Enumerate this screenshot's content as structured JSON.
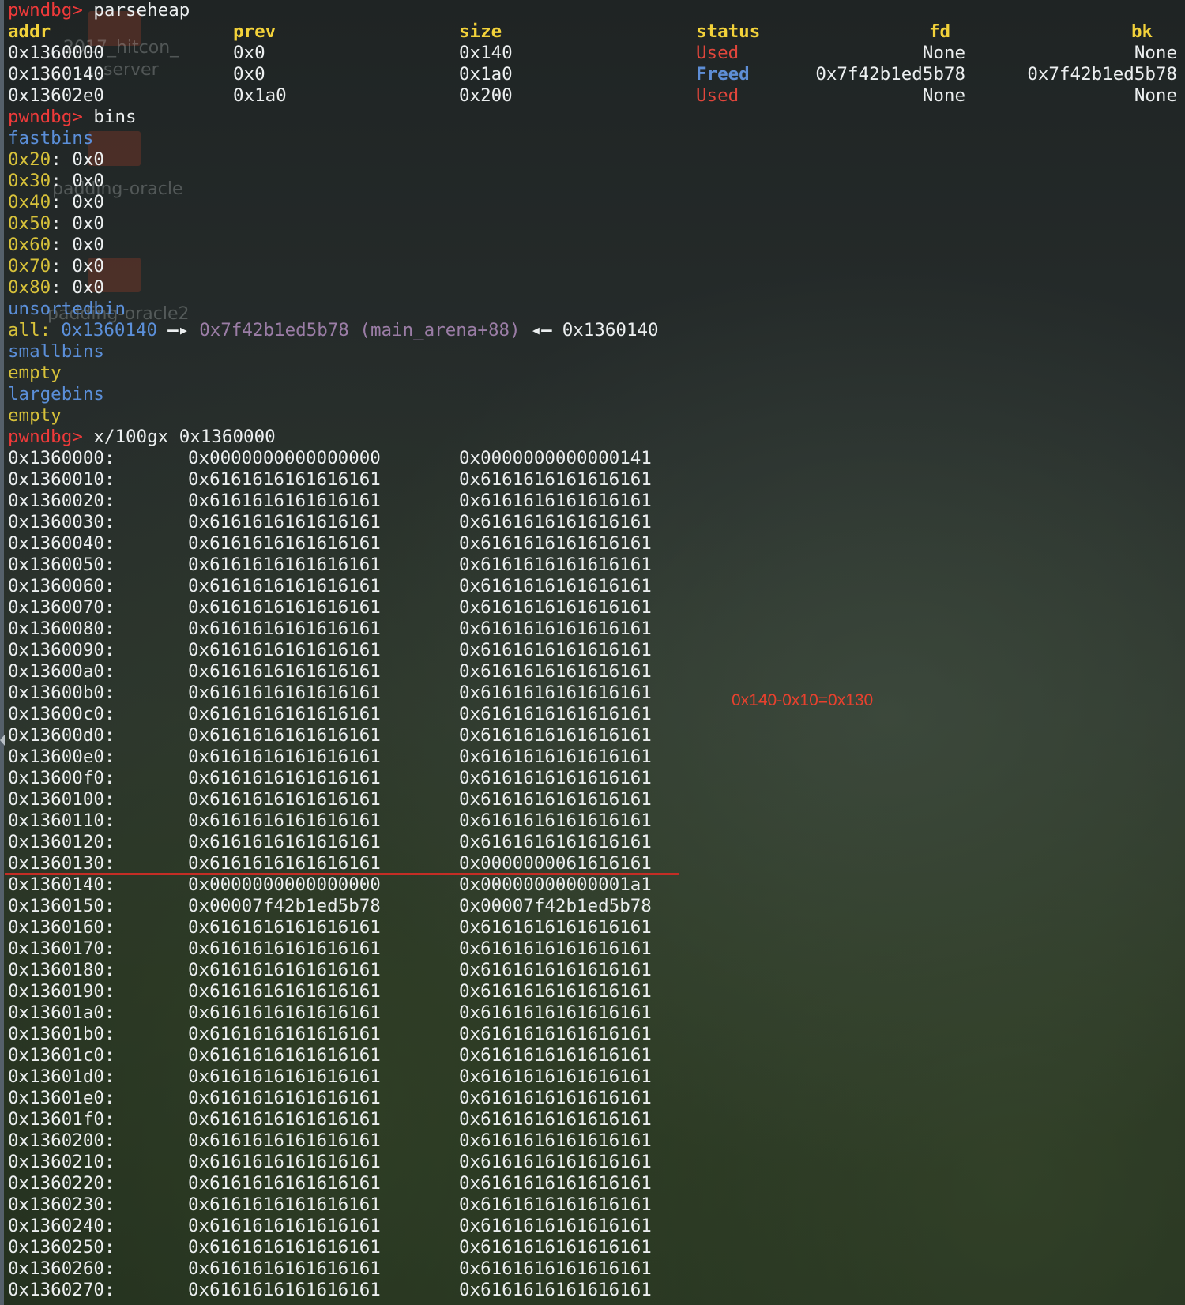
{
  "parseheap": {
    "prompt": "pwndbg>",
    "command": " parseheap",
    "headers": [
      "addr",
      "prev",
      "size",
      "status",
      "fd",
      "bk"
    ],
    "rows": [
      {
        "addr": "0x1360000",
        "prev": "0x0",
        "size": "0x140",
        "status": "Used",
        "fd": "None",
        "bk": "None"
      },
      {
        "addr": "0x1360140",
        "prev": "0x0",
        "size": "0x1a0",
        "status": "Freed",
        "fd": "0x7f42b1ed5b78",
        "bk": "0x7f42b1ed5b78"
      },
      {
        "addr": "0x13602e0",
        "prev": "0x1a0",
        "size": "0x200",
        "status": "Used",
        "fd": "None",
        "bk": "None"
      }
    ]
  },
  "bins": {
    "prompt": "pwndbg>",
    "command": " bins",
    "fastbins_label": "fastbins",
    "fastbins": [
      {
        "size": "0x20",
        "value": " 0x0"
      },
      {
        "size": "0x30",
        "value": " 0x0"
      },
      {
        "size": "0x40",
        "value": " 0x0"
      },
      {
        "size": "0x50",
        "value": " 0x0"
      },
      {
        "size": "0x60",
        "value": " 0x0"
      },
      {
        "size": "0x70",
        "value": " 0x0"
      },
      {
        "size": "0x80",
        "value": " 0x0"
      }
    ],
    "unsortedbin_label": "unsortedbin",
    "unsorted_all": "all:",
    "unsorted_chunk": "0x1360140",
    "unsorted_arrow1": "—▸",
    "unsorted_arena": "0x7f42b1ed5b78 (main_arena+88)",
    "unsorted_arrow2": "◂—",
    "unsorted_back": "0x1360140",
    "smallbins_label": "smallbins",
    "smallbins_value": "empty",
    "largebins_label": "largebins",
    "largebins_value": "empty"
  },
  "examine": {
    "prompt": "pwndbg>",
    "command": " x/100gx 0x1360000",
    "rows": [
      {
        "addr": "0x1360000:",
        "v1": "0x0000000000000000",
        "v2": "0x0000000000000141"
      },
      {
        "addr": "0x1360010:",
        "v1": "0x6161616161616161",
        "v2": "0x6161616161616161"
      },
      {
        "addr": "0x1360020:",
        "v1": "0x6161616161616161",
        "v2": "0x6161616161616161"
      },
      {
        "addr": "0x1360030:",
        "v1": "0x6161616161616161",
        "v2": "0x6161616161616161"
      },
      {
        "addr": "0x1360040:",
        "v1": "0x6161616161616161",
        "v2": "0x6161616161616161"
      },
      {
        "addr": "0x1360050:",
        "v1": "0x6161616161616161",
        "v2": "0x6161616161616161"
      },
      {
        "addr": "0x1360060:",
        "v1": "0x6161616161616161",
        "v2": "0x6161616161616161"
      },
      {
        "addr": "0x1360070:",
        "v1": "0x6161616161616161",
        "v2": "0x6161616161616161"
      },
      {
        "addr": "0x1360080:",
        "v1": "0x6161616161616161",
        "v2": "0x6161616161616161"
      },
      {
        "addr": "0x1360090:",
        "v1": "0x6161616161616161",
        "v2": "0x6161616161616161"
      },
      {
        "addr": "0x13600a0:",
        "v1": "0x6161616161616161",
        "v2": "0x6161616161616161"
      },
      {
        "addr": "0x13600b0:",
        "v1": "0x6161616161616161",
        "v2": "0x6161616161616161"
      },
      {
        "addr": "0x13600c0:",
        "v1": "0x6161616161616161",
        "v2": "0x6161616161616161"
      },
      {
        "addr": "0x13600d0:",
        "v1": "0x6161616161616161",
        "v2": "0x6161616161616161"
      },
      {
        "addr": "0x13600e0:",
        "v1": "0x6161616161616161",
        "v2": "0x6161616161616161"
      },
      {
        "addr": "0x13600f0:",
        "v1": "0x6161616161616161",
        "v2": "0x6161616161616161"
      },
      {
        "addr": "0x1360100:",
        "v1": "0x6161616161616161",
        "v2": "0x6161616161616161"
      },
      {
        "addr": "0x1360110:",
        "v1": "0x6161616161616161",
        "v2": "0x6161616161616161"
      },
      {
        "addr": "0x1360120:",
        "v1": "0x6161616161616161",
        "v2": "0x6161616161616161"
      },
      {
        "addr": "0x1360130:",
        "v1": "0x6161616161616161",
        "v2": "0x0000000061616161"
      },
      {
        "addr": "0x1360140:",
        "v1": "0x0000000000000000",
        "v2": "0x00000000000001a1"
      },
      {
        "addr": "0x1360150:",
        "v1": "0x00007f42b1ed5b78",
        "v2": "0x00007f42b1ed5b78"
      },
      {
        "addr": "0x1360160:",
        "v1": "0x6161616161616161",
        "v2": "0x6161616161616161"
      },
      {
        "addr": "0x1360170:",
        "v1": "0x6161616161616161",
        "v2": "0x6161616161616161"
      },
      {
        "addr": "0x1360180:",
        "v1": "0x6161616161616161",
        "v2": "0x6161616161616161"
      },
      {
        "addr": "0x1360190:",
        "v1": "0x6161616161616161",
        "v2": "0x6161616161616161"
      },
      {
        "addr": "0x13601a0:",
        "v1": "0x6161616161616161",
        "v2": "0x6161616161616161"
      },
      {
        "addr": "0x13601b0:",
        "v1": "0x6161616161616161",
        "v2": "0x6161616161616161"
      },
      {
        "addr": "0x13601c0:",
        "v1": "0x6161616161616161",
        "v2": "0x6161616161616161"
      },
      {
        "addr": "0x13601d0:",
        "v1": "0x6161616161616161",
        "v2": "0x6161616161616161"
      },
      {
        "addr": "0x13601e0:",
        "v1": "0x6161616161616161",
        "v2": "0x6161616161616161"
      },
      {
        "addr": "0x13601f0:",
        "v1": "0x6161616161616161",
        "v2": "0x6161616161616161"
      },
      {
        "addr": "0x1360200:",
        "v1": "0x6161616161616161",
        "v2": "0x6161616161616161"
      },
      {
        "addr": "0x1360210:",
        "v1": "0x6161616161616161",
        "v2": "0x6161616161616161"
      },
      {
        "addr": "0x1360220:",
        "v1": "0x6161616161616161",
        "v2": "0x6161616161616161"
      },
      {
        "addr": "0x1360230:",
        "v1": "0x6161616161616161",
        "v2": "0x6161616161616161"
      },
      {
        "addr": "0x1360240:",
        "v1": "0x6161616161616161",
        "v2": "0x6161616161616161"
      },
      {
        "addr": "0x1360250:",
        "v1": "0x6161616161616161",
        "v2": "0x6161616161616161"
      },
      {
        "addr": "0x1360260:",
        "v1": "0x6161616161616161",
        "v2": "0x6161616161616161"
      },
      {
        "addr": "0x1360270:",
        "v1": "0x6161616161616161",
        "v2": "0x6161616161616161"
      }
    ]
  },
  "annotation": "0x140-0x10=0x130",
  "desktop_watermarks": [
    "2017_hitcon_",
    "…_server",
    "padding-oracle",
    "padding-oracle2"
  ],
  "colors": {
    "prompt": "#ef3a3a",
    "header": "#f3d23a",
    "used": "#e2463c",
    "freed": "#5e8ed6",
    "bin_label": "#5b8fd9",
    "fast_size": "#d8c23a",
    "arena": "#9b7da6",
    "annotation": "#e8412e"
  }
}
